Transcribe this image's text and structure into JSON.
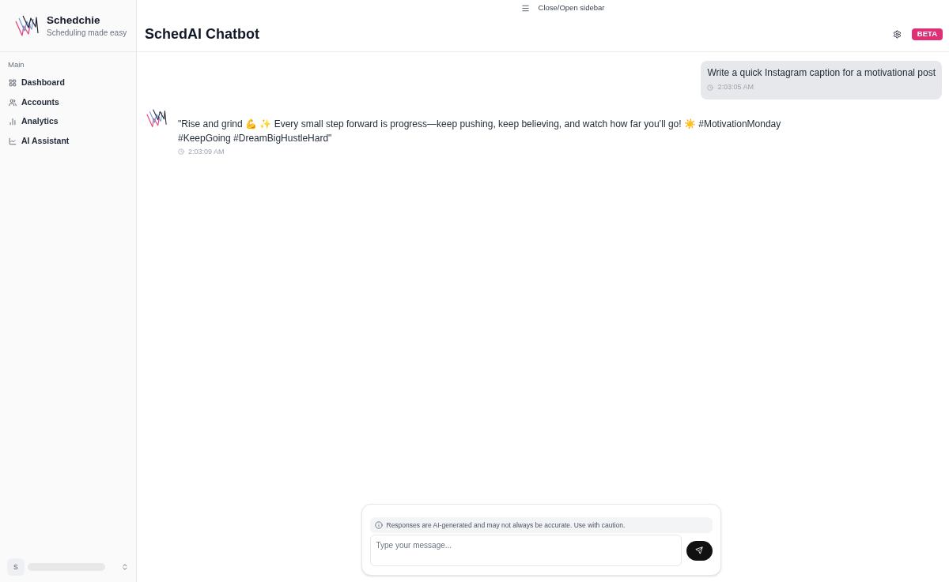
{
  "sidebar": {
    "brand": {
      "name": "Schedchie",
      "tagline": "Scheduling made easy"
    },
    "section_label": "Main",
    "items": [
      {
        "label": "Dashboard",
        "selected": false
      },
      {
        "label": "Accounts",
        "selected": false
      },
      {
        "label": "Analytics",
        "selected": false
      },
      {
        "label": "AI Assistant",
        "selected": false
      }
    ],
    "user": {
      "initial": "S"
    }
  },
  "topbar": {
    "toggle_label": "Close/Open sidebar"
  },
  "header": {
    "title": "SchedAI Chatbot",
    "badge": "BETA"
  },
  "messages": [
    {
      "kind": "user",
      "text": "Write a quick Instagram caption for a motivational post",
      "time": "2:03:05 AM"
    },
    {
      "kind": "bot",
      "text": "\"Rise and grind 💪 ✨ Every small step forward is progress—keep pushing, keep believing, and watch how far you’ll go! ☀️ #MotivationMonday #KeepGoing #DreamBigHustleHard\"",
      "time": "2:03:09 AM"
    }
  ],
  "composer": {
    "notice": "Responses are AI-generated and may not always be accurate. Use with caution.",
    "placeholder": "Type your message..."
  }
}
